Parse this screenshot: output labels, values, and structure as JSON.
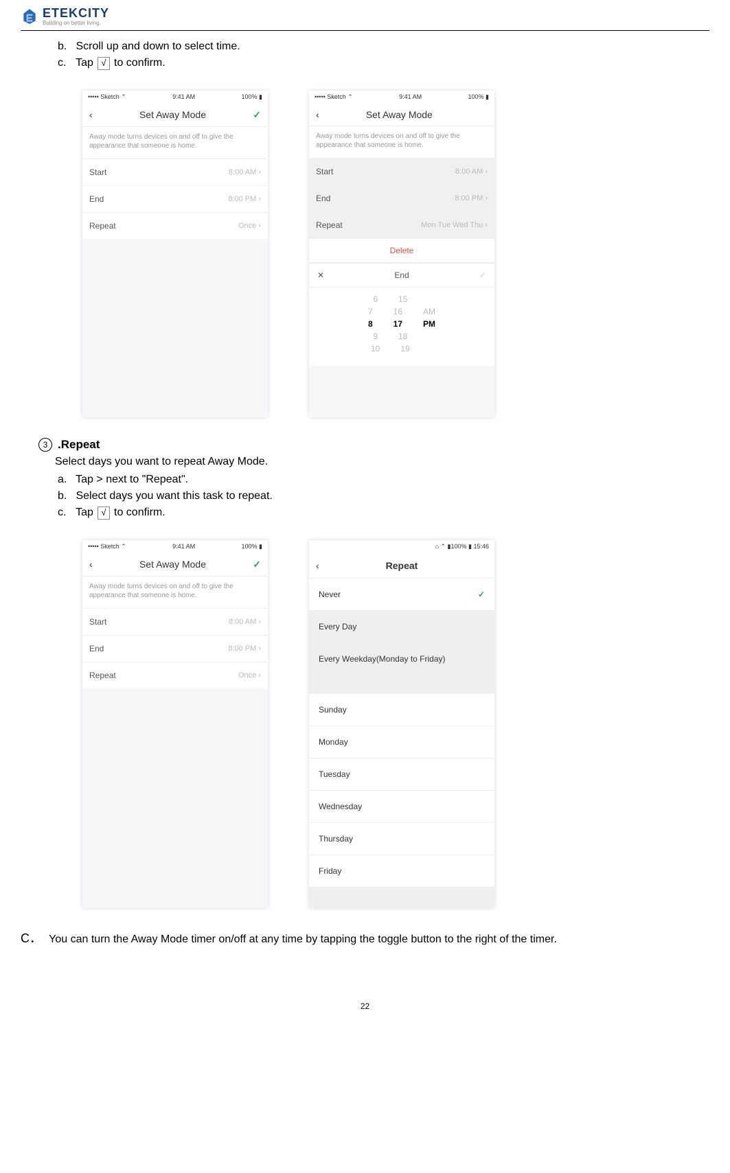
{
  "header": {
    "brand": "ETEKCITY",
    "tagline": "Building on better living."
  },
  "steps_top": {
    "b": {
      "letter": "b.",
      "text": "Scroll up and down to select time."
    },
    "c": {
      "letter": "c.",
      "prefix": "Tap",
      "symbol": "√",
      "suffix": "to confirm."
    }
  },
  "shot1": {
    "status_left": "••••• Sketch ⌃",
    "status_center": "9:41 AM",
    "status_right": "100% ▮",
    "back": "‹",
    "title": "Set Away Mode",
    "confirm": "✓",
    "sub": "Away mode turns devices on and off to give the appearance that someone is home.",
    "row_start_label": "Start",
    "row_start_val": "8:00 AM  ›",
    "row_end_label": "End",
    "row_end_val": "8:00 PM  ›",
    "row_repeat_label": "Repeat",
    "row_repeat_val": "Once  ›"
  },
  "shot2": {
    "status_left": "••••• Sketch ⌃",
    "status_center": "9:41 AM",
    "status_right": "100% ▮",
    "back": "‹",
    "title": "Set Away Mode",
    "sub": "Away mode turns devices on and off to give the appearance that someone is home.",
    "row_start_label": "Start",
    "row_start_val": "8:00 AM  ›",
    "row_end_label": "End",
    "row_end_val": "8:00 PM  ›",
    "row_repeat_label": "Repeat",
    "row_repeat_val": "Mon Tue Wed Thu  ›",
    "delete": "Delete",
    "picker_close": "✕",
    "picker_title": "End",
    "picker_confirm": "✓",
    "picker": {
      "h1": "6",
      "m1": "15",
      "h2": "7",
      "m2": "16",
      "ap2": "AM",
      "h3": "8",
      "m3": "17",
      "ap3": "PM",
      "h4": "9",
      "m4": "18",
      "h5": "10",
      "m5": "19"
    }
  },
  "section3": {
    "num": "3",
    "title": ".Repeat",
    "desc": "Select days you want to repeat Away Mode.",
    "a": {
      "letter": "a.",
      "text": "Tap > next to \"Repeat\"."
    },
    "b": {
      "letter": "b.",
      "text": "Select days you want this task to repeat."
    },
    "c": {
      "letter": "c.",
      "prefix": "Tap",
      "symbol": "√",
      "suffix": "to confirm."
    }
  },
  "shot3": {
    "status_left": "••••• Sketch ⌃",
    "status_center": "9:41 AM",
    "status_right": "100% ▮",
    "back": "‹",
    "title": "Set Away Mode",
    "confirm": "✓",
    "sub": "Away mode turns devices on and off to give the appearance that someone is home.",
    "row_start_label": "Start",
    "row_start_val": "8:00 AM  ›",
    "row_end_label": "End",
    "row_end_val": "8:00 PM  ›",
    "row_repeat_label": "Repeat",
    "row_repeat_val": "Once  ›"
  },
  "shot4": {
    "status": "⌂ ⌃ ▮100% ▮ 15:46",
    "back": "‹",
    "title": "Repeat",
    "r1": "Never",
    "r1_chk": "✓",
    "r2": "Every Day",
    "r3": "Every Weekday(Monday to Friday)",
    "r4": "Sunday",
    "r5": "Monday",
    "r6": "Tuesday",
    "r7": "Wednesday",
    "r8": "Thursday",
    "r9": "Friday"
  },
  "noteC": {
    "label": "C．",
    "text": "You can turn the Away Mode timer on/off at any time by tapping the toggle button to the right of the timer."
  },
  "pagenum": "22"
}
